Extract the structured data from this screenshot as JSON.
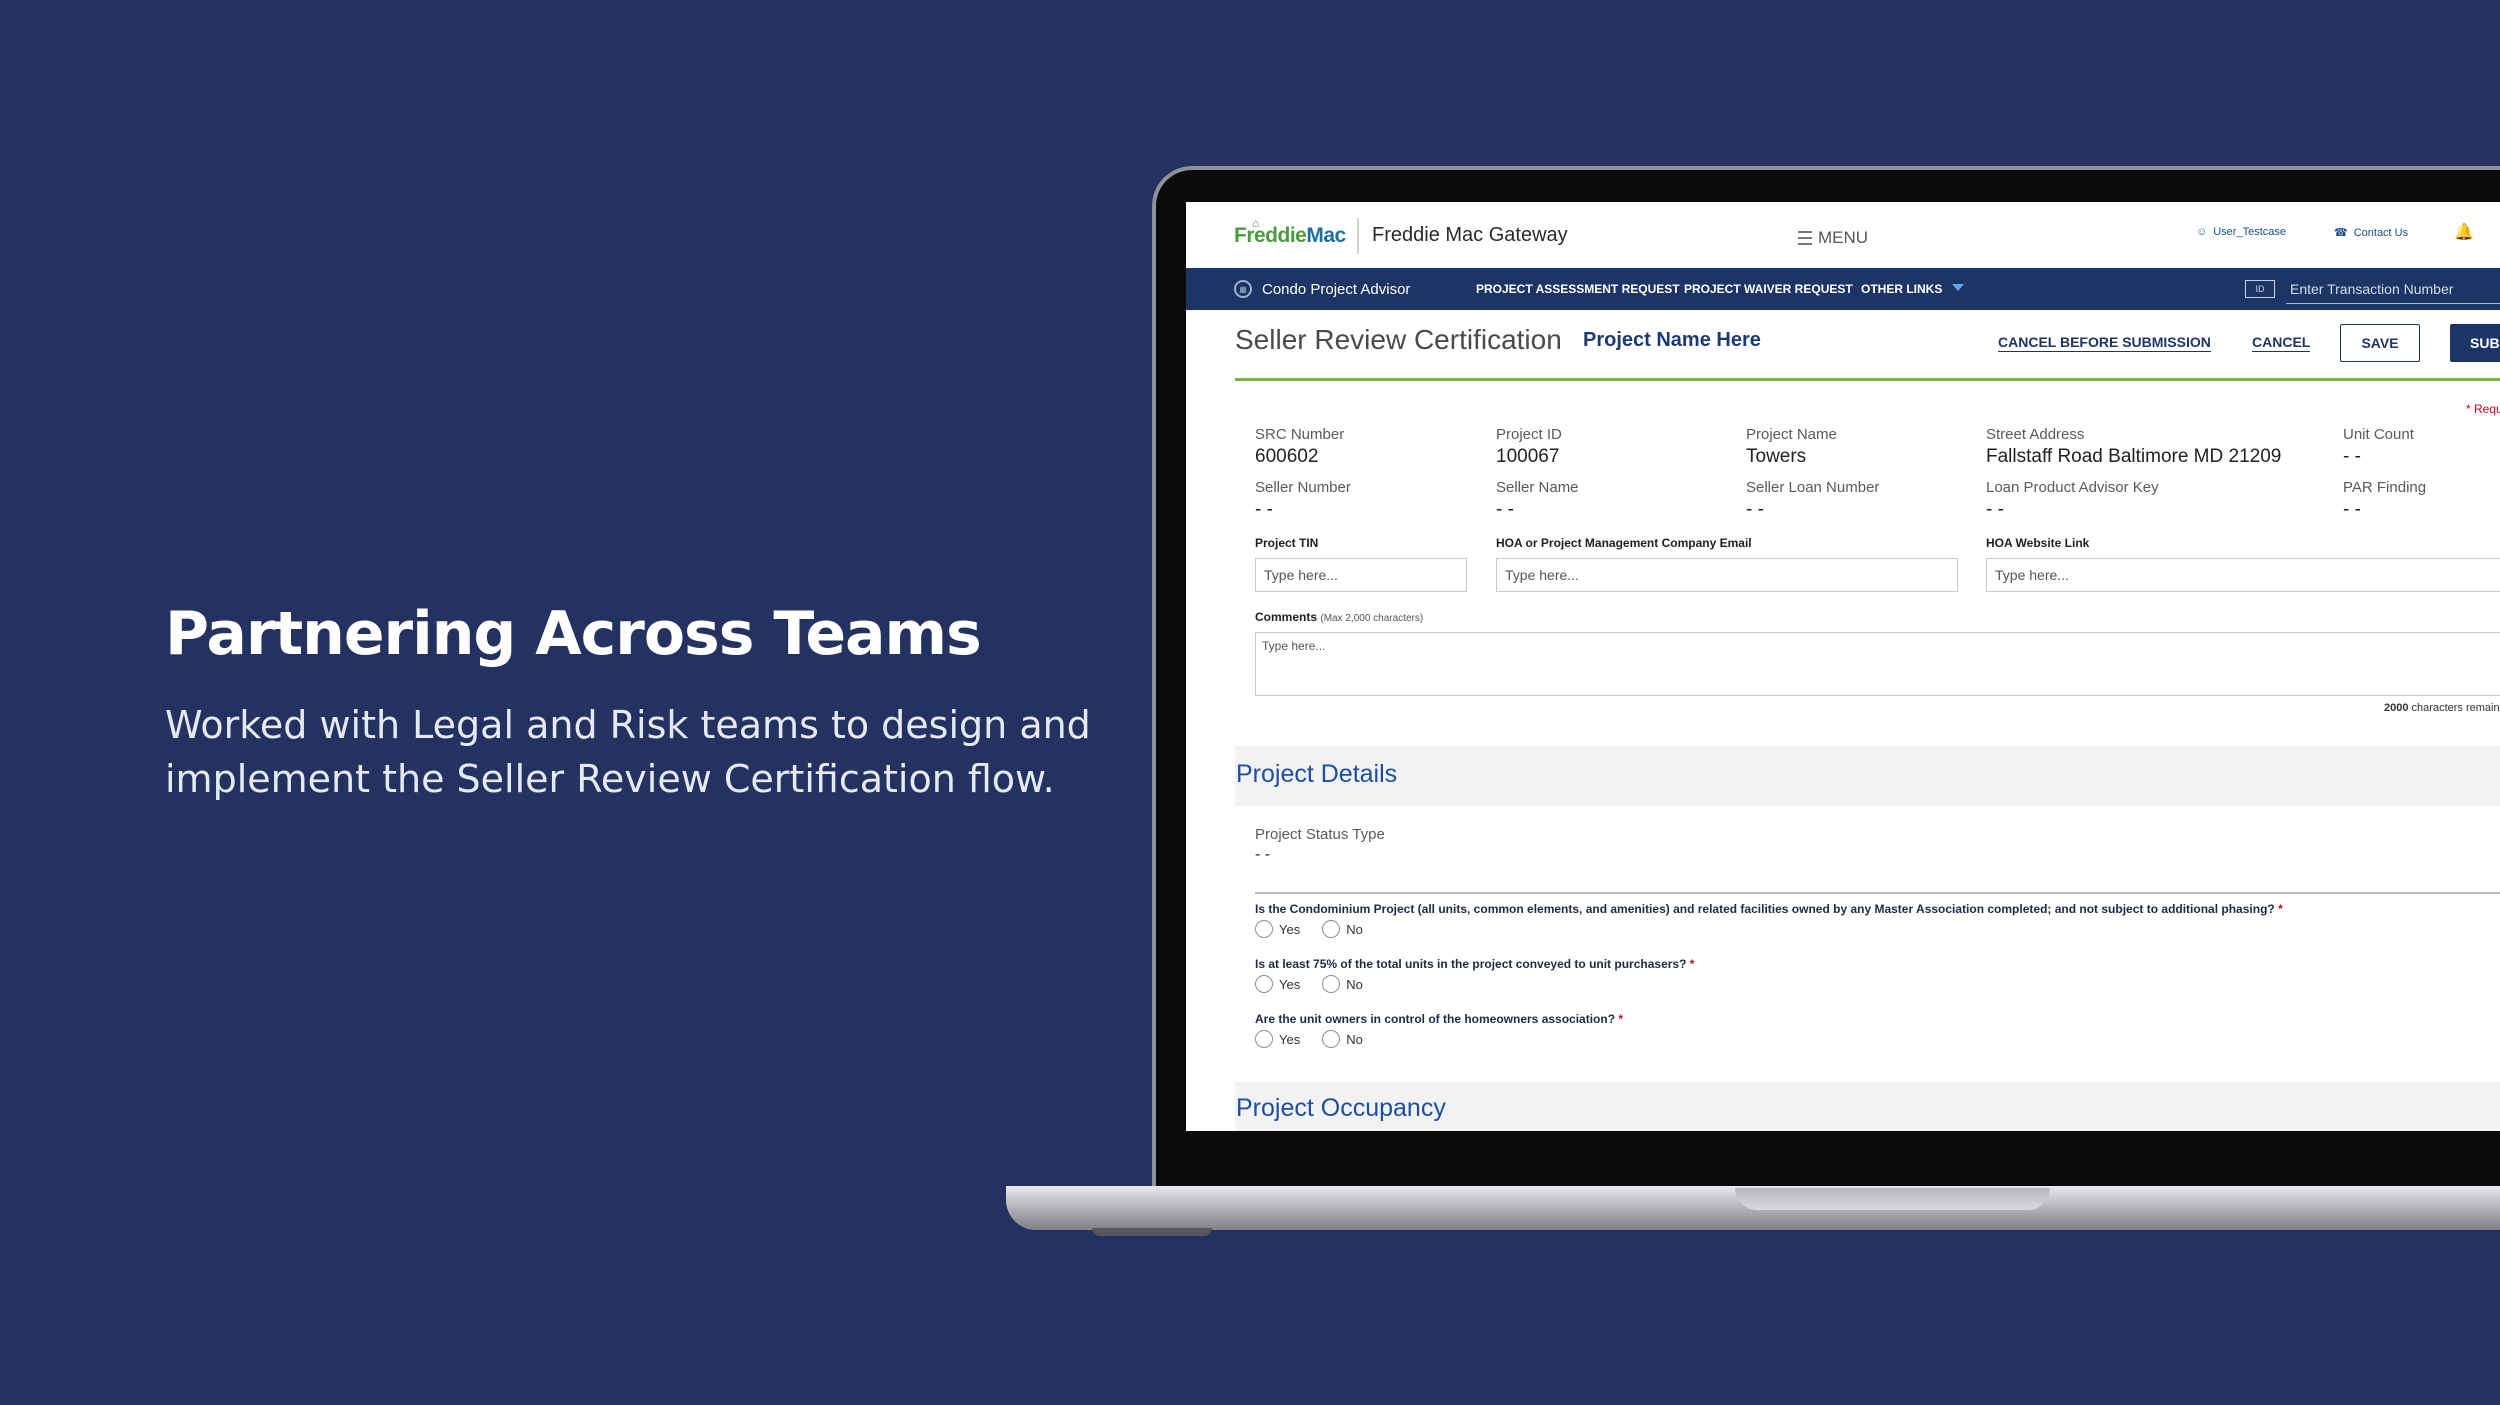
{
  "hero": {
    "title": "Partnering Across Teams",
    "line1": "Worked with Legal and Risk teams to design and",
    "line2": "implement the Seller Review Certification flow."
  },
  "app": {
    "logo_part1": "Freddie",
    "logo_part2": "Mac",
    "gateway_title": "Freddie Mac Gateway",
    "menu_label": "MENU",
    "user_label": "User_Testcase",
    "contact_label": "Contact Us"
  },
  "nav": {
    "app_name": "Condo Project Advisor",
    "links": [
      "PROJECT ASSESSMENT REQUEST",
      "PROJECT WAIVER REQUEST",
      "OTHER LINKS"
    ],
    "transaction_placeholder": "Enter Transaction Number"
  },
  "page": {
    "title": "Seller Review Certification",
    "project_name": "Project Name Here",
    "cancel_before_submission": "CANCEL BEFORE SUBMISSION",
    "cancel": "CANCEL",
    "save": "SAVE",
    "submit": "SUBMIT",
    "required_note": "* Required"
  },
  "summary": [
    {
      "label": "SRC Number",
      "value": "600602"
    },
    {
      "label": "Project ID",
      "value": "100067"
    },
    {
      "label": "Project Name",
      "value": "Towers"
    },
    {
      "label": "Street Address",
      "value": "Fallstaff Road Baltimore MD 21209"
    },
    {
      "label": "Unit Count",
      "value": "- -"
    },
    {
      "label": "Seller Number",
      "value": "- -"
    },
    {
      "label": "Seller Name",
      "value": "- -"
    },
    {
      "label": "Seller Loan Number",
      "value": "- -"
    },
    {
      "label": "Loan Product Advisor Key",
      "value": "- -"
    },
    {
      "label": "PAR Finding",
      "value": "- -"
    }
  ],
  "inputs": {
    "project_tin_label": "Project TIN",
    "hoa_email_label": "HOA or Project Management Company Email",
    "hoa_website_label": "HOA Website Link",
    "placeholder": "Type here...",
    "comments_label": "Comments",
    "comments_hint": "(Max 2,000 characters)",
    "chars_remaining_count": "2000",
    "chars_remaining_text": "characters remaining"
  },
  "project_details": {
    "section_title": "Project Details",
    "status_label": "Project Status Type",
    "status_value": "- -",
    "questions": [
      "Is the Condominium Project (all units, common elements, and amenities) and related facilities owned by any Master Association completed; and not subject to additional phasing?",
      "Is at least 75% of the total units in the project conveyed to unit purchasers?",
      "Are the unit owners in control of the homeowners association?"
    ],
    "required_mark": "*",
    "yes": "Yes",
    "no": "No"
  },
  "project_occupancy": {
    "section_title": "Project Occupancy"
  },
  "colors": {
    "background": "#233261",
    "nav": "#1d3566",
    "accent_green": "#7cb342",
    "link_blue": "#1d4fa0",
    "required_red": "#d0021b"
  }
}
